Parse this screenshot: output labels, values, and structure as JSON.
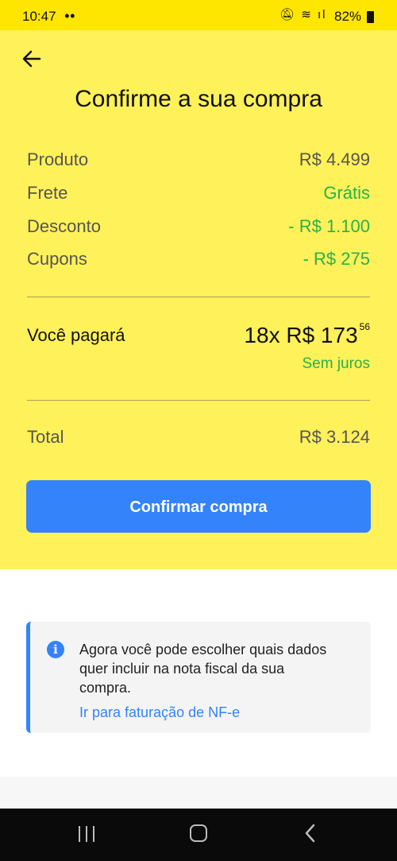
{
  "status": {
    "time": "10:47",
    "battery": "82%"
  },
  "page": {
    "title": "Confirme a sua compra"
  },
  "summary": [
    {
      "label": "Produto",
      "value": "R$ 4.499",
      "green": false
    },
    {
      "label": "Frete",
      "value": "Grátis",
      "green": true
    },
    {
      "label": "Desconto",
      "value": "- R$ 1.100",
      "green": true
    },
    {
      "label": "Cupons",
      "value": "- R$ 275",
      "green": true
    }
  ],
  "payment": {
    "label": "Você pagará",
    "installments": "18x R$ 173",
    "cents": "56",
    "interest": "Sem juros"
  },
  "total": {
    "label": "Total",
    "value": "R$ 3.124"
  },
  "confirm_label": "Confirmar compra",
  "info": {
    "icon": "info-icon",
    "text": "Agora você pode escolher quais dados quer incluir na nota fiscal da sua compra.",
    "link": "Ir para faturação de NF-e"
  },
  "colors": {
    "header": "#fff159",
    "accent": "#3483fa",
    "green": "#2ab14a"
  }
}
